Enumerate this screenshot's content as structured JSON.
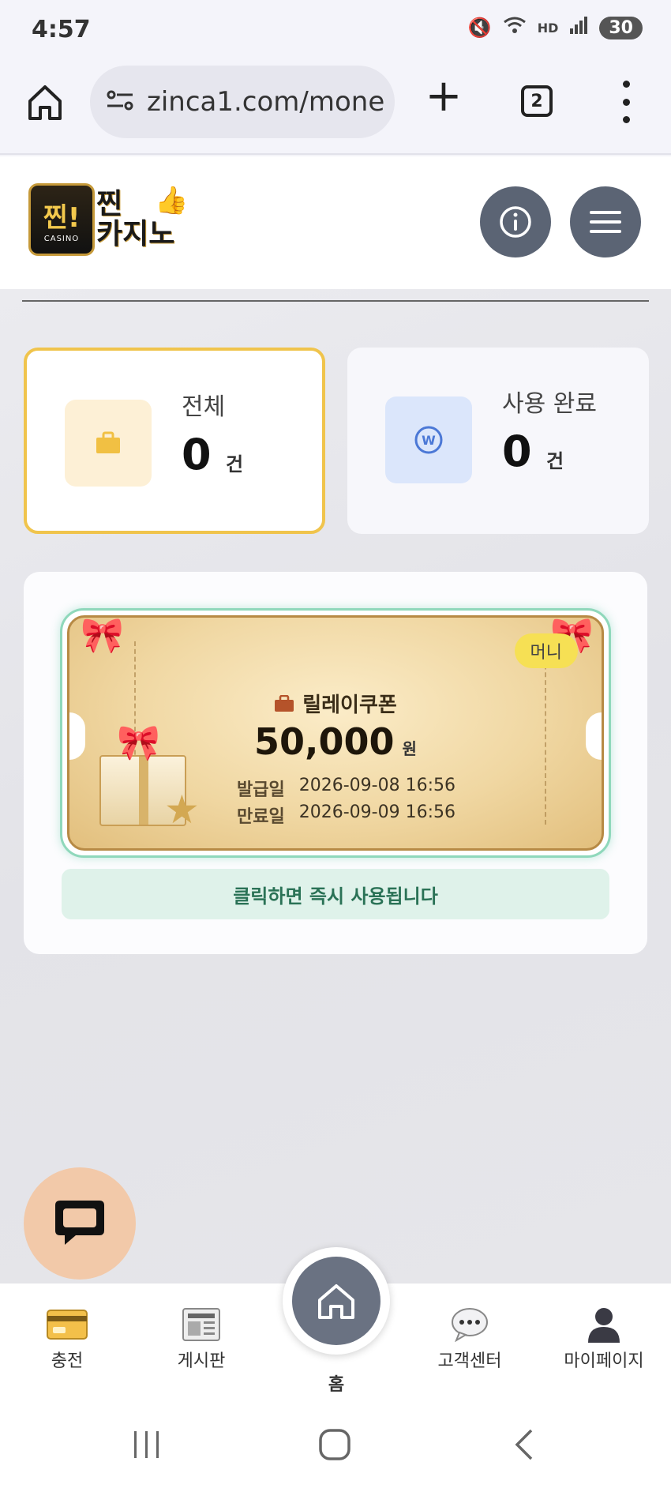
{
  "status_bar": {
    "time": "4:57",
    "battery": "30",
    "hd_label": "HD"
  },
  "browser": {
    "url": "zinca1.com/mone",
    "tab_count": "2"
  },
  "header": {
    "logo_badge": "찐!",
    "logo_badge_sub": "CASINO",
    "logo_word_top": "찐",
    "logo_word_bottom": "카지노"
  },
  "stats": [
    {
      "label": "전체",
      "value": "0",
      "unit": "건",
      "icon": "briefcase-icon"
    },
    {
      "label": "사용 완료",
      "value": "0",
      "unit": "건",
      "icon": "won-coin-icon"
    }
  ],
  "coupon": {
    "badge": "머니",
    "title": "릴레이쿠폰",
    "amount": "50,000",
    "currency": "원",
    "issue_label": "발급일",
    "issue_date": "2026-09-08 16:56",
    "expire_label": "만료일",
    "expire_date": "2026-09-09 16:56",
    "use_hint": "클릭하면 즉시 사용됩니다"
  },
  "bottom_nav": {
    "items": [
      {
        "label": "충전",
        "icon": "credit-card-icon"
      },
      {
        "label": "게시판",
        "icon": "newspaper-icon"
      },
      {
        "label": "홈",
        "icon": "home-icon"
      },
      {
        "label": "고객센터",
        "icon": "speech-bubble-icon"
      },
      {
        "label": "마이페이지",
        "icon": "user-icon"
      }
    ]
  },
  "colors": {
    "accent_yellow": "#f0c44c",
    "coupon_border": "#8fd8bb",
    "nav_button": "#5b6474",
    "use_text": "#2a7256"
  }
}
